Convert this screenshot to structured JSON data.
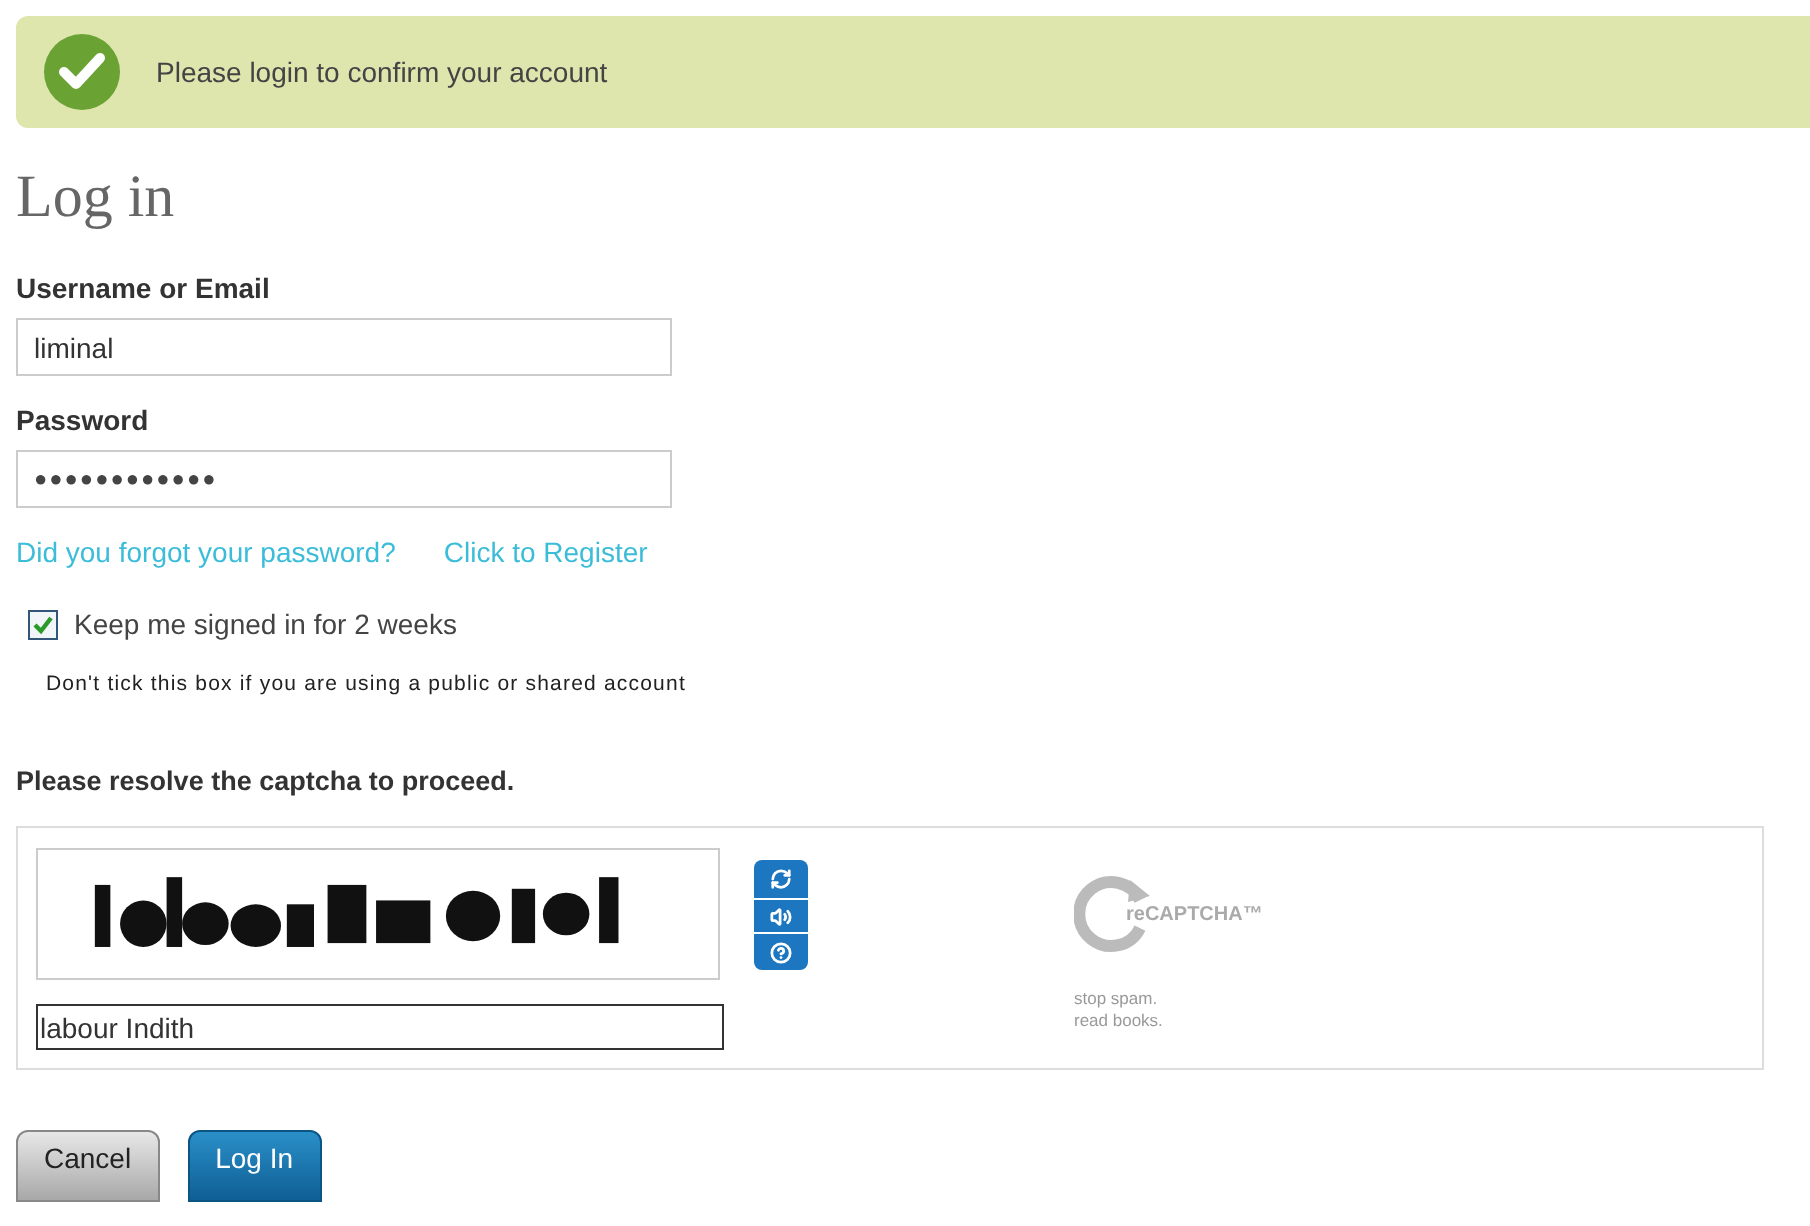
{
  "notice": {
    "text": "Please login to confirm your account"
  },
  "title": "Log in",
  "username": {
    "label": "Username or Email",
    "value": "liminal"
  },
  "password": {
    "label": "Password",
    "value": "●●●●●●●●●●●●"
  },
  "links": [
    "Did you forgot your password?",
    "Click to Register"
  ],
  "remember": {
    "label": "Keep me signed in for 2 weeks",
    "checked": true,
    "hint": "Don't tick this box if you are using a public or shared account"
  },
  "captcha": {
    "prompt": "Please resolve the captcha to proceed.",
    "answer": "labour Indith",
    "logo": "reCAPTCHA™",
    "tagline": [
      "stop spam.",
      "read books."
    ]
  },
  "buttons": [
    {
      "label": "Cancel",
      "kind": "secondary"
    },
    {
      "label": "Log In",
      "kind": "primary"
    }
  ]
}
